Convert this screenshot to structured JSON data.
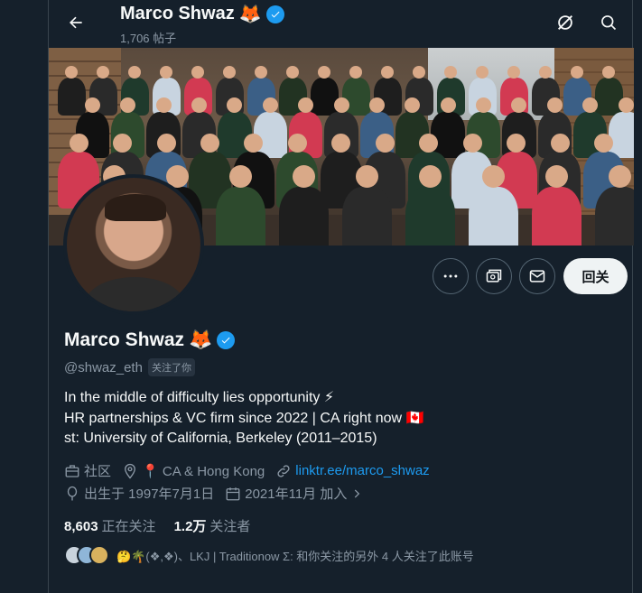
{
  "header": {
    "name": "Marco Shwaz",
    "name_emoji": "🦊",
    "posts_count": "1,706 帖子",
    "icons": [
      "back-arrow-icon",
      "grok-icon",
      "search-icon"
    ]
  },
  "actions": {
    "more_icon": "more-icon",
    "subscribe_icon": "subscribe-icon",
    "message_icon": "mail-icon",
    "follow_label": "回关"
  },
  "profile": {
    "name": "Marco Shwaz",
    "name_emoji": "🦊",
    "handle": "@shwaz_eth",
    "follows_you": "关注了你",
    "bio": [
      "In the middle of difficulty lies opportunity ⚡",
      "HR partnerships & VC firm since 2022 | CA right now 🇨🇦",
      "st: University of California, Berkeley (2011–2015)"
    ],
    "category": "社区",
    "location": "📍 CA & Hong Kong",
    "link": "linktr.ee/marco_shwaz",
    "birthday": "出生于 1997年7月1日",
    "joined": "2021年11月 加入"
  },
  "stats": {
    "following_count": "8,603",
    "following_label": "正在关注",
    "followers_count": "1.2万",
    "followers_label": "关注者"
  },
  "known_followers": {
    "text": "🤔🌴(❖,❖)、LKJ | Traditionow Σ: 和你关注的另外 4 人关注了此账号"
  },
  "colors": {
    "background": "#15202b",
    "accent": "#1d9bf0",
    "muted": "#8b98a5",
    "border": "#38444d"
  }
}
